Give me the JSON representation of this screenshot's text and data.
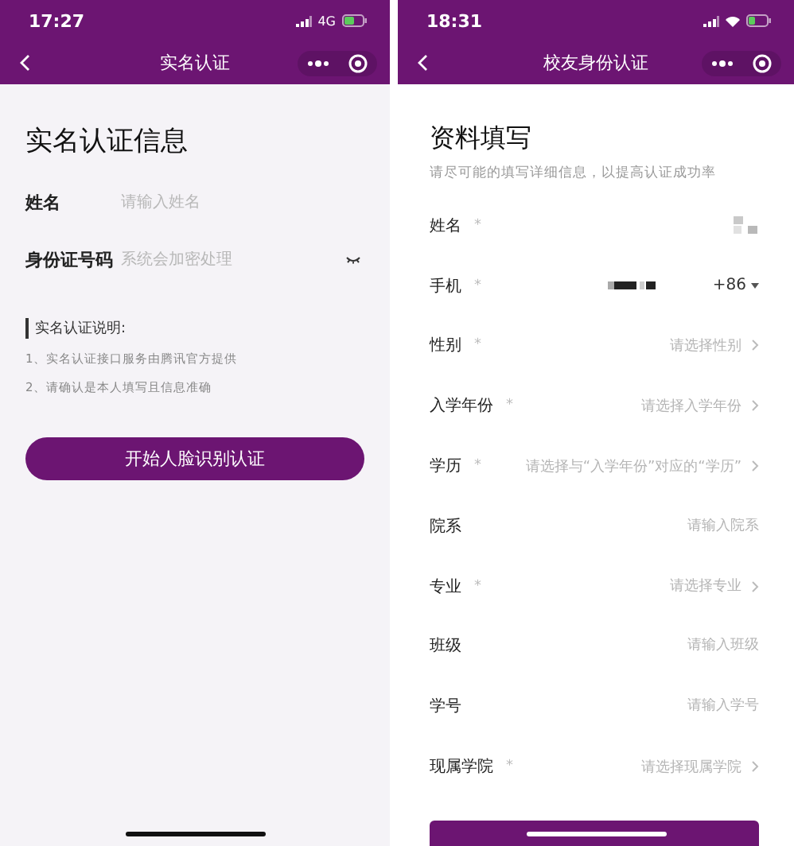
{
  "left_screen": {
    "status": {
      "time": "17:27",
      "network": "4G"
    },
    "nav": {
      "title": "实名认证"
    },
    "heading": "实名认证信息",
    "fields": [
      {
        "label": "姓名",
        "placeholder": "请输入姓名",
        "kind": "text"
      },
      {
        "label": "身份证号码",
        "placeholder": "系统会加密处理",
        "kind": "secret"
      }
    ],
    "notes": {
      "title": "实名认证说明:",
      "items": [
        "1、实名认证接口服务由腾讯官方提供",
        "2、请确认是本人填写且信息准确"
      ]
    },
    "button": "开始人脸识别认证"
  },
  "right_screen": {
    "status": {
      "time": "18:31"
    },
    "nav": {
      "title": "校友身份认证"
    },
    "heading": "资料填写",
    "subtitle": "请尽可能的填写详细信息，以提高认证成功率",
    "rows": [
      {
        "label": "姓名",
        "required_mark": "*",
        "kind": "masked"
      },
      {
        "label": "手机",
        "required_mark": "*",
        "kind": "phone",
        "code": "+86"
      },
      {
        "label": "性别",
        "required_mark": "*",
        "kind": "select",
        "placeholder": "请选择性别"
      },
      {
        "label": "入学年份",
        "required_mark": "*",
        "kind": "select",
        "placeholder": "请选择入学年份"
      },
      {
        "label": "学历",
        "required_mark": "*",
        "kind": "select",
        "placeholder": "请选择与“入学年份”对应的“学历”"
      },
      {
        "label": "院系",
        "kind": "input",
        "placeholder": "请输入院系"
      },
      {
        "label": "专业",
        "required_mark": "*",
        "kind": "select",
        "placeholder": "请选择专业"
      },
      {
        "label": "班级",
        "kind": "input",
        "placeholder": "请输入班级"
      },
      {
        "label": "学号",
        "kind": "input",
        "placeholder": "请输入学号"
      },
      {
        "label": "现属学院",
        "required_mark": "*",
        "kind": "select",
        "placeholder": "请选择现属学院"
      }
    ]
  }
}
